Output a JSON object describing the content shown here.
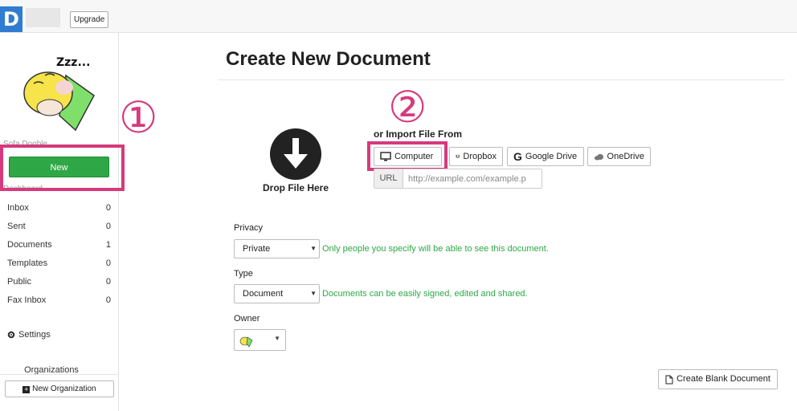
{
  "topbar": {
    "logo_letter": "D",
    "upgrade_label": "Upgrade"
  },
  "sidebar": {
    "faded_top": "Sofa Dooble",
    "new_label": "New",
    "faded_dashboard": "Dashboard",
    "items": [
      {
        "label": "Inbox",
        "count": "0"
      },
      {
        "label": "Sent",
        "count": "0"
      },
      {
        "label": "Documents",
        "count": "1"
      },
      {
        "label": "Templates",
        "count": "0"
      },
      {
        "label": "Public",
        "count": "0"
      },
      {
        "label": "Fax Inbox",
        "count": "0"
      }
    ],
    "settings_label": "Settings",
    "organizations_label": "Organizations",
    "new_org_label": "New Organization",
    "illustration_text": "Zzz..."
  },
  "annotations": {
    "one": "①",
    "two": "②",
    "color": "#d63a7c"
  },
  "main": {
    "title": "Create New Document",
    "drop_label": "Drop File Here",
    "import_label": "or Import File From",
    "import_buttons": [
      {
        "label": "Computer",
        "icon": "monitor-icon"
      },
      {
        "label": "Dropbox",
        "icon": "dropbox-icon"
      },
      {
        "label": "Google Drive",
        "icon": "google-icon"
      },
      {
        "label": "OneDrive",
        "icon": "cloud-icon"
      }
    ],
    "url_addon": "URL",
    "url_placeholder": "http://example.com/example.p",
    "privacy_label": "Privacy",
    "privacy_value": "Private",
    "privacy_help": "Only people you specify will be able to see this document.",
    "type_label": "Type",
    "type_value": "Document",
    "type_help": "Documents can be easily signed, edited and shared.",
    "owner_label": "Owner",
    "blank_doc_label": "Create Blank Document"
  },
  "colors": {
    "brand_blue": "#2f7dd1",
    "new_green": "#2ea846",
    "help_green": "#2ea846"
  }
}
